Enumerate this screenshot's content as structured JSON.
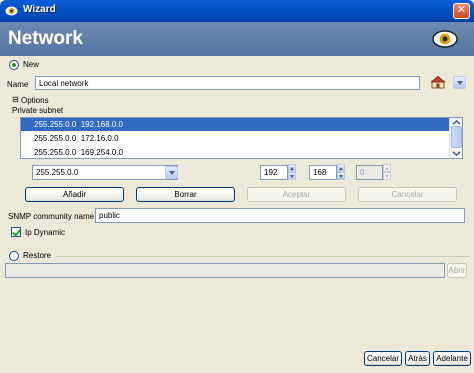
{
  "window": {
    "title": "Wizard",
    "close_symbol": "✕"
  },
  "header": {
    "title": "Network"
  },
  "new_section": {
    "radio_label": "New",
    "name_label": "Name",
    "name_value": "Local network",
    "options_label": "Options",
    "options_toggle": "⊟",
    "private_subnet_label": "Private subnet",
    "subnets": [
      {
        "mask": "255.255.0.0",
        "network": "192.168.0.0",
        "selected": true
      },
      {
        "mask": "255.255.0.0",
        "network": "172.16.0.0",
        "selected": false
      },
      {
        "mask": "255.255.0.0",
        "network": "169.254.0.0",
        "selected": false
      }
    ],
    "mask_select": "255.255.0.0",
    "octet1": "192",
    "octet2": "168",
    "octet3": "0",
    "buttons": {
      "add": "Añadir",
      "delete": "Borrar",
      "accept": "Aceptar",
      "cancel": "Cancelar"
    },
    "snmp_label": "SNMP community name :",
    "snmp_value": "public",
    "ip_dynamic_label": "Ip Dynamic",
    "ip_dynamic_checked": true
  },
  "restore_section": {
    "radio_label": "Restore",
    "path_value": "",
    "open_button": "Abrir"
  },
  "footer": {
    "cancel": "Cancelar",
    "back": "Atrás",
    "next": "Adelante"
  },
  "colors": {
    "title_bar": "#0352c7",
    "header": "#5e7ca9",
    "selection": "#316ac5",
    "dialog_bg": "#ece9d8"
  }
}
